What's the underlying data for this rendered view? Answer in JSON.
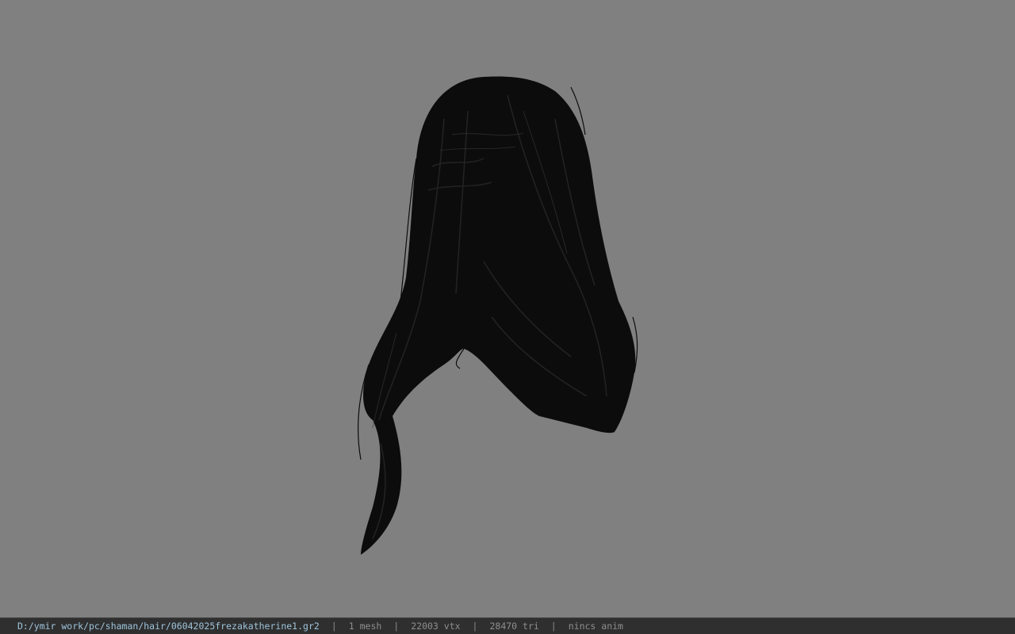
{
  "viewport": {
    "background": "#808080",
    "model_color": "#0c0c0c"
  },
  "status_bar": {
    "file_path": "D:/ymir work/pc/shaman/hair/06042025frezakatherine1.gr2",
    "separator": "|",
    "mesh_count": "1 mesh",
    "vertex_count": "22003 vtx",
    "triangle_count": "28470 tri",
    "anim_status": "nincs anim",
    "path_color": "#9ec4dc"
  }
}
